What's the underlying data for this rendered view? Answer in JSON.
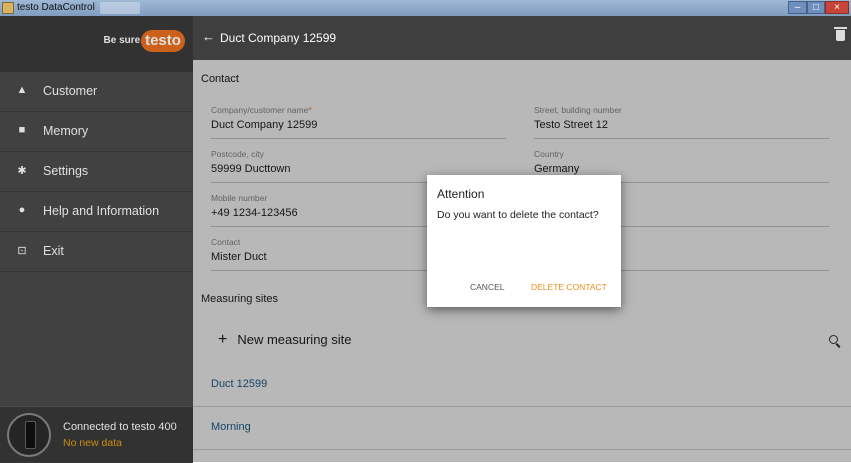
{
  "window": {
    "title": "testo DataControl"
  },
  "sidebar": {
    "brand_tag": "Be sure.",
    "brand_logo": "testo",
    "items": [
      {
        "label": "Customer",
        "icon": "person-icon"
      },
      {
        "label": "Memory",
        "icon": "briefcase-icon"
      },
      {
        "label": "Settings",
        "icon": "gear-icon"
      },
      {
        "label": "Help and Information",
        "icon": "info-icon"
      },
      {
        "label": "Exit",
        "icon": "exit-icon"
      }
    ],
    "device": {
      "status": "Connected to testo 400",
      "substatus": "No new data"
    }
  },
  "header": {
    "back_glyph": "←",
    "title": "Duct Company 12599"
  },
  "contact": {
    "section_title": "Contact",
    "company_label": "Company/customer name",
    "company_required": "*",
    "company_value": "Duct Company 12599",
    "street_label": "Street, building number",
    "street_value": "Testo Street 12",
    "postcode_label": "Postcode, city",
    "postcode_value": "59999 Ducttown",
    "country_label": "Country",
    "country_value": "Germany",
    "mobile_label": "Mobile number",
    "mobile_value": "+49 1234-123456",
    "contact_label": "Contact",
    "contact_value": "Mister Duct"
  },
  "measuring": {
    "section_title": "Measuring sites",
    "new_label": "New measuring site",
    "sites": [
      "Duct 12599",
      "Morning"
    ]
  },
  "dialog": {
    "title": "Attention",
    "message": "Do you want to delete the contact?",
    "cancel": "CANCEL",
    "confirm": "DELETE CONTACT"
  },
  "colors": {
    "accent": "#e86f1e",
    "link": "#1f5f8c",
    "dialog_action": "#e8901c"
  }
}
